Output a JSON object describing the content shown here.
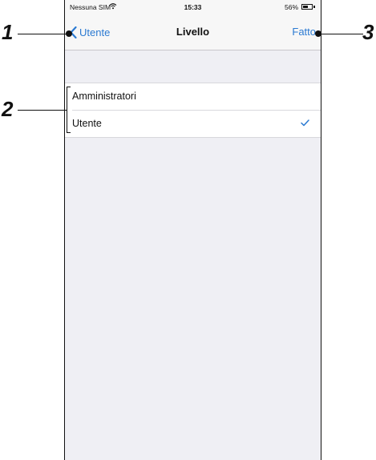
{
  "status_bar": {
    "carrier": "Nessuna SIM",
    "time": "15:33",
    "battery_percent": "56%",
    "battery_level": 0.56
  },
  "nav": {
    "back_label": "Utente",
    "title": "Livello",
    "done_label": "Fatto"
  },
  "levels": {
    "items": [
      {
        "label": "Amministratori",
        "selected": false
      },
      {
        "label": "Utente",
        "selected": true
      }
    ]
  },
  "callouts": {
    "one": "1",
    "two": "2",
    "three": "3"
  },
  "colors": {
    "accent": "#2b7ad2",
    "background": "#efeff4"
  },
  "icons": {
    "back": "chevron-left-icon",
    "check": "checkmark-icon",
    "wifi": "wifi-icon"
  }
}
